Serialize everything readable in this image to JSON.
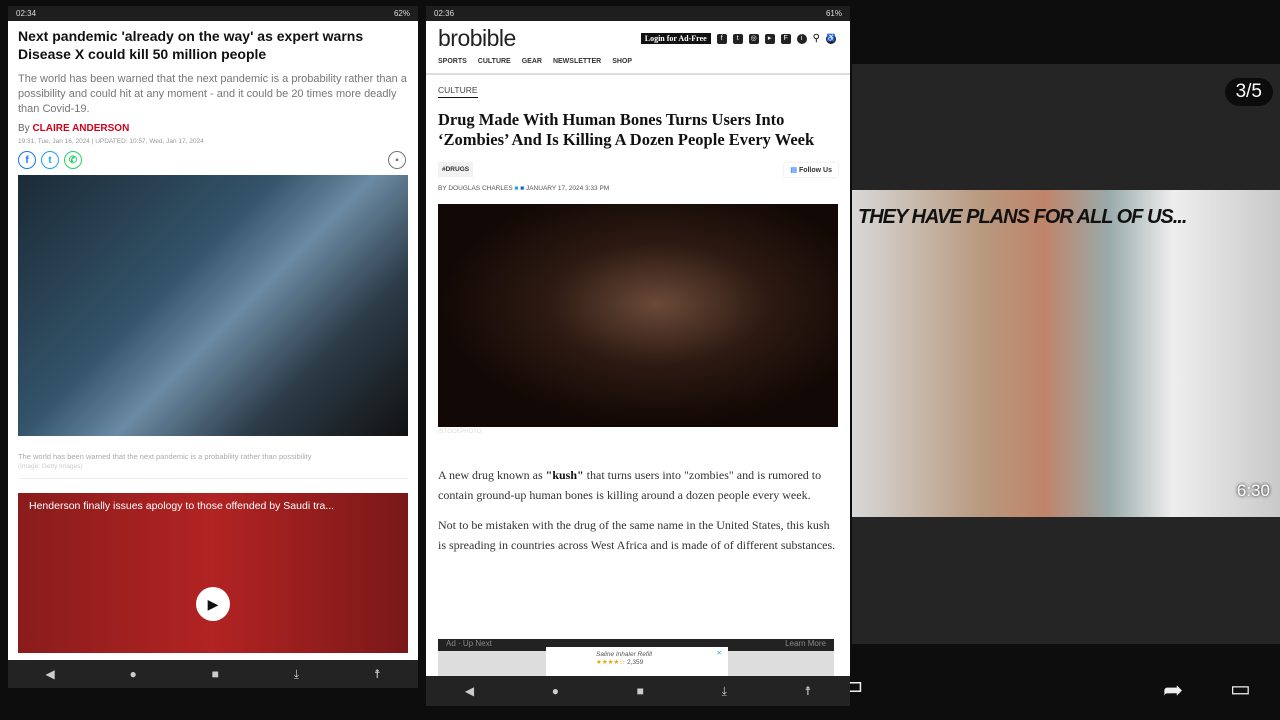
{
  "left_phone": {
    "status": {
      "time": "02:34",
      "battery": "62%"
    },
    "headline": "Next pandemic 'already on the way' as expert warns Disease X could kill 50 million people",
    "standfirst": "The world has been warned that the next pandemic is a probability rather than a possibility and could hit at any moment - and it could be 20 times more deadly than Covid-19.",
    "by_prefix": "By",
    "author": "CLAIRE ANDERSON",
    "dates": "19:31, Tue, Jan 16, 2024 | UPDATED: 10:57, Wed, Jan 17, 2024",
    "share_icons": [
      "facebook-icon",
      "twitter-icon",
      "whatsapp-icon"
    ],
    "caption": "The world has been warned that the next pandemic is a probability rather than possibility",
    "caption_credit": "(Image: Getty Images)",
    "video_title": "Henderson finally issues apology to those offended by Saudi tra..."
  },
  "mid_phone": {
    "status": {
      "time": "02:36",
      "battery": "61%"
    },
    "logo": "brobible",
    "login_label": "Login for Ad-Free",
    "menu": [
      "SPORTS",
      "CULTURE",
      "GEAR",
      "NEWSLETTER",
      "SHOP"
    ],
    "kicker": "CULTURE",
    "headline": "Drug Made With Human Bones Turns Users Into ‘Zombies’ And Is Killing A Dozen People Every Week",
    "tag": "#DRUGS",
    "follow_label": "Follow Us",
    "byline": "BY DOUGLAS CHARLES",
    "date": "JANUARY 17, 2024 3:33 PM",
    "image_credit": "ISTOCKPHOTO",
    "para1_pre": "A new drug known as ",
    "para1_bold": "\"kush\"",
    "para1_post": " that turns users into \"zombies\" and is rumored to contain ground-up human bones is killing around a dozen people every week.",
    "para2": "Not to be mistaken with the drug of the same name in the United States, this kush is spreading in countries across West Africa and is made of of different substances.",
    "ad": {
      "label": "Ad",
      "up_next": "Up Next",
      "learn_more": "Learn More",
      "product": "Saline Inhaler Refill",
      "rating_count": "2,359",
      "rating": 4.5
    }
  },
  "right_panel": {
    "counter": "3/5",
    "thumbnail_text": "THEY HAVE PLANS FOR ALL OF US...",
    "duration": "6:30"
  },
  "colors": {
    "author_red": "#d0021b",
    "facebook": "#1877f2",
    "twitter": "#1da1f2",
    "whatsapp": "#25d366"
  }
}
